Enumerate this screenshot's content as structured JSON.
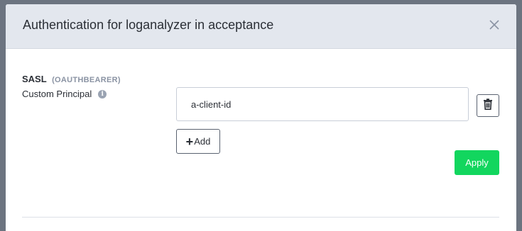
{
  "modal": {
    "title": "Authentication for loganalyzer in acceptance",
    "close_icon": "close-icon"
  },
  "auth": {
    "type_label": "SASL",
    "mechanism": "(OAUTHBEARER)",
    "principal_label": "Custom Principal",
    "info_icon": "info-icon",
    "principal_value": "a-client-id",
    "delete_icon": "trash-icon",
    "add_label": "Add",
    "apply_label": "Apply"
  },
  "colors": {
    "header_bg": "#e3e7ee",
    "apply_bg": "#12d65e",
    "backdrop": "#6c7480"
  }
}
